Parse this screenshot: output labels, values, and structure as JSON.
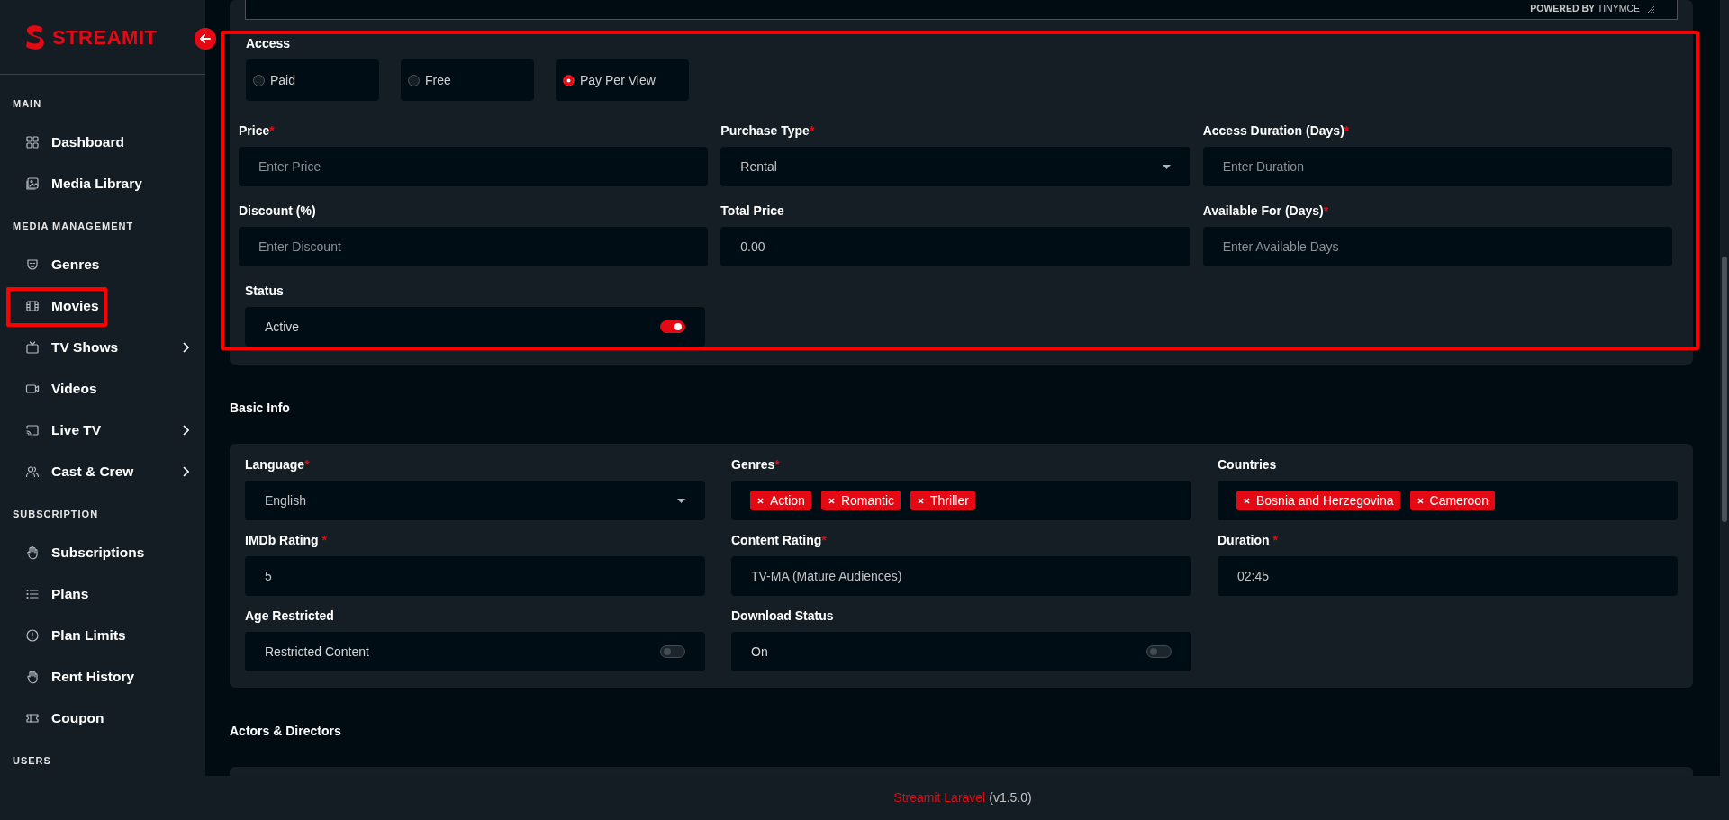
{
  "sidebar": {
    "brand": "STREAMIT",
    "sections": [
      {
        "title": "MAIN",
        "items": [
          {
            "label": "Dashboard",
            "expandable": false,
            "highlighted": false
          },
          {
            "label": "Media Library",
            "expandable": false,
            "highlighted": false
          }
        ]
      },
      {
        "title": "MEDIA MANAGEMENT",
        "items": [
          {
            "label": "Genres",
            "expandable": false,
            "highlighted": false
          },
          {
            "label": "Movies",
            "expandable": false,
            "highlighted": true
          },
          {
            "label": "TV Shows",
            "expandable": true,
            "highlighted": false
          },
          {
            "label": "Videos",
            "expandable": false,
            "highlighted": false
          },
          {
            "label": "Live TV",
            "expandable": true,
            "highlighted": false
          },
          {
            "label": "Cast & Crew",
            "expandable": true,
            "highlighted": false
          }
        ]
      },
      {
        "title": "SUBSCRIPTION",
        "items": [
          {
            "label": "Subscriptions",
            "expandable": false,
            "highlighted": false
          },
          {
            "label": "Plans",
            "expandable": false,
            "highlighted": false
          },
          {
            "label": "Plan Limits",
            "expandable": false,
            "highlighted": false
          },
          {
            "label": "Rent History",
            "expandable": false,
            "highlighted": false
          },
          {
            "label": "Coupon",
            "expandable": false,
            "highlighted": false
          }
        ]
      },
      {
        "title": "USERS"
      }
    ]
  },
  "editor": {
    "powered_by": "**POWERED BY** TINYMCE"
  },
  "pricing": {
    "highlighted": true,
    "access": {
      "label": "Access",
      "options": [
        {
          "label": "Paid",
          "selected": false
        },
        {
          "label": "Free",
          "selected": false
        },
        {
          "label": "Pay Per View",
          "selected": true
        }
      ]
    },
    "fields": [
      {
        "kind": "input",
        "label": "Price",
        "required": "*",
        "placeholder": "Enter Price"
      },
      {
        "kind": "select",
        "label": "Purchase Type",
        "required": "*",
        "value": "Rental"
      },
      {
        "kind": "input",
        "label": "Access Duration (Days)",
        "required": "*",
        "placeholder": "Enter Duration"
      },
      {
        "kind": "input",
        "label": "Discount (%)",
        "placeholder": "Enter Discount"
      },
      {
        "kind": "input",
        "label": "Total Price",
        "value": "0.00"
      },
      {
        "kind": "input",
        "label": "Available For (Days)",
        "required": "*",
        "placeholder": "Enter Available Days"
      },
      {
        "kind": "toggle",
        "label": "Status",
        "text": "Active",
        "on": true
      }
    ]
  },
  "basic_info": {
    "heading": "Basic Info",
    "fields": [
      {
        "kind": "select",
        "label": "Language",
        "required": "*",
        "value": "English"
      },
      {
        "kind": "tags",
        "label": "Genres",
        "required": "*",
        "tags": [
          "Action",
          "Romantic",
          "Thriller"
        ]
      },
      {
        "kind": "tags",
        "label": "Countries",
        "tags": [
          "Bosnia and Herzegovina",
          "Cameroon"
        ]
      },
      {
        "kind": "input",
        "label": "IMDb Rating",
        "required": " *",
        "value": "5"
      },
      {
        "kind": "input",
        "label": "Content Rating",
        "required": "*",
        "value": "TV-MA (Mature Audiences)"
      },
      {
        "kind": "input",
        "label": "Duration",
        "required": " *",
        "value": "02:45"
      },
      {
        "kind": "toggle",
        "label": "Age Restricted",
        "text": "Restricted Content",
        "on": false
      },
      {
        "kind": "toggle",
        "label": "Download Status",
        "text": "On",
        "on": false
      }
    ]
  },
  "actors": {
    "heading": "Actors & Directors"
  },
  "footer": {
    "link": "Streamit Laravel",
    "version": "(v1.5.0)"
  }
}
